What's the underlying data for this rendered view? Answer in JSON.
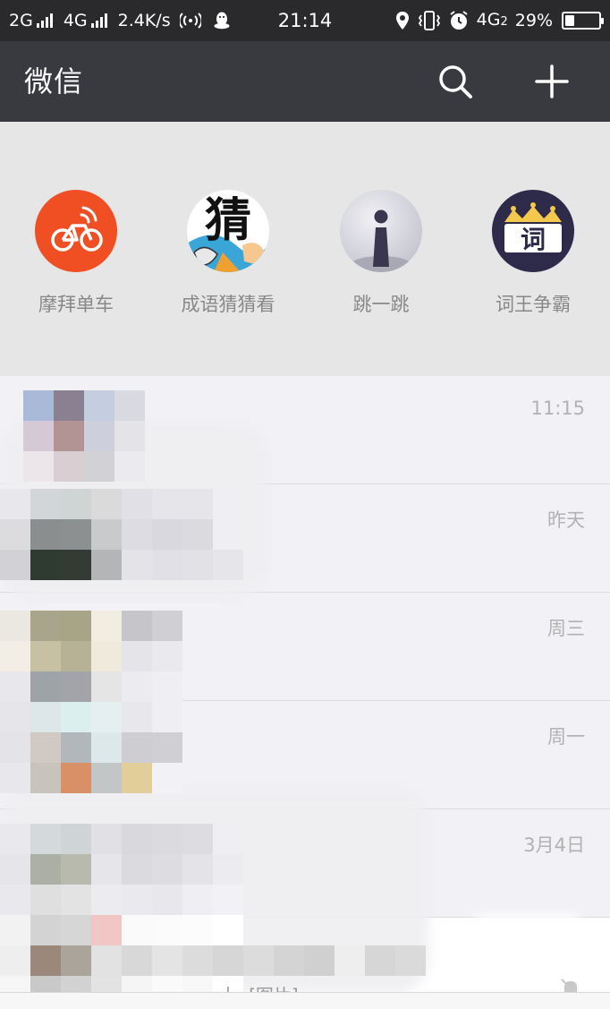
{
  "status_bar": {
    "net1": "2G",
    "net2": "4G",
    "speed": "2.4K/s",
    "time": "21:14",
    "net3": "4G",
    "net3_sub": "2",
    "battery": "29%",
    "battery_level": 0.29
  },
  "header": {
    "title": "微信",
    "search_icon": "search-icon",
    "add_icon": "plus-icon"
  },
  "mini_programs": [
    {
      "label": "摩拜单车",
      "icon": "mobike-bicycle-icon",
      "color": "#f04e23"
    },
    {
      "label": "成语猜猜看",
      "icon": "idiom-guess-icon",
      "glyph": "猜",
      "color": "#ffffff"
    },
    {
      "label": "跳一跳",
      "icon": "jump-game-icon",
      "color": "#c9c9d6"
    },
    {
      "label": "词王争霸",
      "icon": "word-king-crown-icon",
      "glyph": "词",
      "color": "#2e2a4a"
    }
  ],
  "chats": [
    {
      "time": "11:15"
    },
    {
      "time": "昨天"
    },
    {
      "time": "周三"
    },
    {
      "time": "周一"
    },
    {
      "time": "3月4日"
    }
  ],
  "last_preview": "大: [图片]",
  "colors": {
    "status_bar_bg": "#2a2a2c",
    "header_bg": "#393a3f",
    "panel_bg": "#e6e6e6",
    "list_bg": "#f2f2f6"
  }
}
